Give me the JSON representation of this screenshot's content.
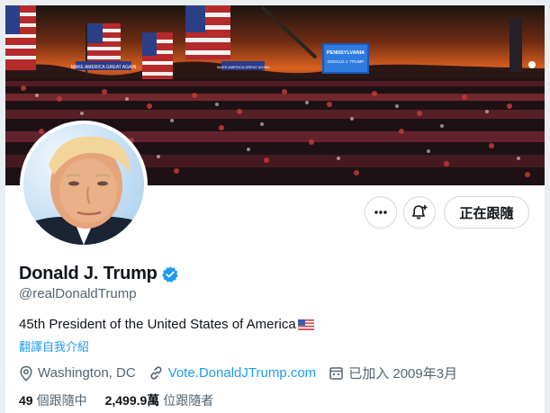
{
  "profile": {
    "display_name": "Donald J. Trump",
    "handle": "@realDonaldTrump",
    "verified_icon": "verified-badge-icon",
    "bio": "45th President of the United States of America",
    "bio_emoji": "us-flag-emoji",
    "translate_label": "翻譯自我介紹",
    "location": "Washington, DC",
    "website": "Vote.DonaldJTrump.com",
    "joined": "已加入 2009年3月"
  },
  "actions": {
    "more_icon": "more-icon",
    "notify_icon": "bell-plus-icon",
    "follow_label": "正在跟隨"
  },
  "stats": {
    "following_count": "49",
    "following_label": "個跟隨中",
    "followers_count": "2,499.9萬",
    "followers_label": "位跟隨者"
  },
  "banner": {
    "sign_main": "PENNSYLVANIA",
    "sign_sub": "DONALD J. TRUMP",
    "sign_small_left": "MAKE AMERICA GREAT AGAIN",
    "sign_small_right": "MAKE AMERICA GREAT AGAIN"
  },
  "colors": {
    "accent": "#1d9bf0",
    "text_primary": "#0f1419",
    "text_secondary": "#536471",
    "border": "#cfd9de"
  }
}
